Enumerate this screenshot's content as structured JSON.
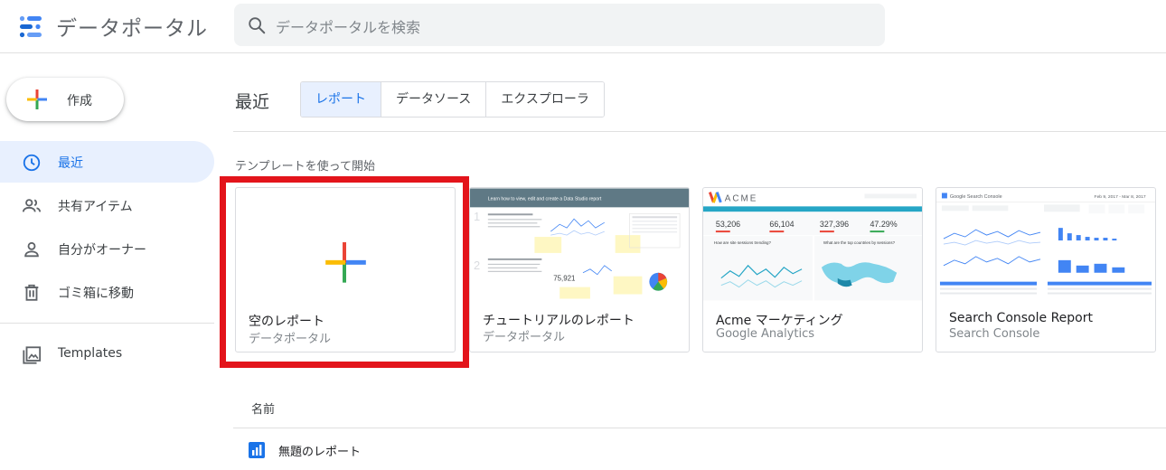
{
  "header": {
    "app_title": "データポータル",
    "logo_icon": "data-studio-logo",
    "search_placeholder": "データポータルを検索"
  },
  "sidebar": {
    "create_label": "作成",
    "items": [
      {
        "label": "最近",
        "icon": "clock-icon",
        "active": true
      },
      {
        "label": "共有アイテム",
        "icon": "people-icon",
        "active": false
      },
      {
        "label": "自分がオーナー",
        "icon": "person-icon",
        "active": false
      },
      {
        "label": "ゴミ箱に移動",
        "icon": "trash-icon",
        "active": false
      },
      {
        "label": "Templates",
        "icon": "image-icon",
        "active": false
      }
    ]
  },
  "main": {
    "title": "最近",
    "tabs": [
      {
        "label": "レポート",
        "active": true
      },
      {
        "label": "データソース",
        "active": false
      },
      {
        "label": "エクスプローラ",
        "active": false
      }
    ],
    "templates_heading": "テンプレートを使って開始",
    "templates": [
      {
        "title": "空のレポート",
        "subtitle": "データポータル"
      },
      {
        "title": "チュートリアルのレポート",
        "subtitle": "データポータル"
      },
      {
        "title": "Acme マーケティング",
        "subtitle": "Google Analytics"
      },
      {
        "title": "Search Console Report",
        "subtitle": "Search Console"
      }
    ],
    "thumbs": {
      "tutorial_header": "Learn how to view, edit and create a Data Studio report",
      "tutorial_value": "75,921",
      "acme_brand": "ACME",
      "acme_metrics": [
        "53,206",
        "66,104",
        "327,396",
        "47.29%"
      ],
      "acme_q1": "How are site sessions trending?",
      "acme_q2": "What are the top countries by sessions?",
      "gsc_brand": "Google Search Console",
      "gsc_date": "Feb 9, 2017 - Mar 8, 2017"
    },
    "list": {
      "column_name": "名前",
      "rows": [
        {
          "name": "無題のレポート"
        }
      ]
    }
  },
  "colors": {
    "accent": "#1a73e8",
    "highlight": "#e3141b",
    "active_bg": "#e8f0fe",
    "acme_teal": "#26a6c6"
  }
}
